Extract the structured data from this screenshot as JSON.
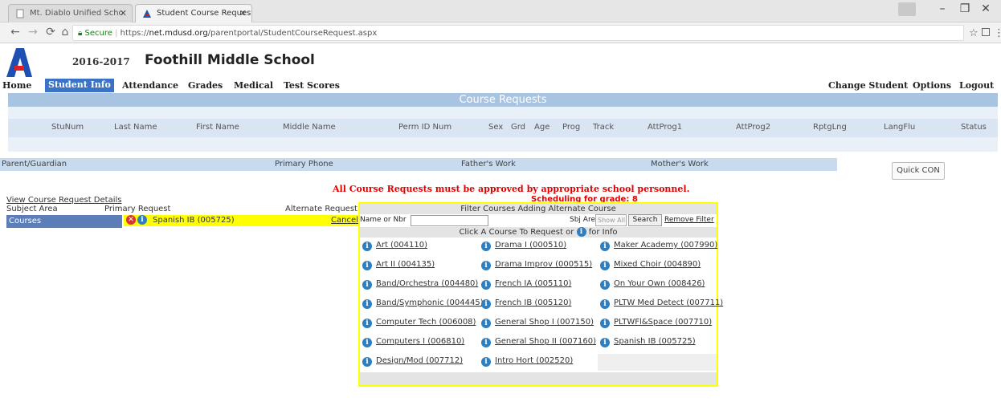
{
  "browser": {
    "tabs": [
      {
        "title": "Mt. Diablo Unified Scho"
      },
      {
        "title": "Student Course Requests"
      }
    ],
    "address": {
      "secure_label": "Secure",
      "url_scheme": "https://",
      "url_host": "net.mdusd.org",
      "url_path": "/parentportal/StudentCourseRequest.aspx"
    }
  },
  "header": {
    "year": "2016-2017",
    "school": "Foothill Middle School"
  },
  "nav": {
    "left": [
      "Home",
      "Student Info",
      "Attendance",
      "Grades",
      "Medical",
      "Test Scores"
    ],
    "active": "Student Info",
    "right": [
      "Change Student",
      "Options",
      "Logout"
    ]
  },
  "course_requests": {
    "title": "Course Requests",
    "columns": [
      "StuNum",
      "Last Name",
      "First Name",
      "Middle Name",
      "Perm ID Num",
      "Sex",
      "Grd",
      "Age",
      "Prog",
      "Track",
      "AttProg1",
      "AttProg2",
      "RptgLng",
      "LangFlu",
      "Status"
    ]
  },
  "parent_bar": {
    "labels": [
      "Parent/Guardian",
      "Primary Phone",
      "Father's Work",
      "Mother's Work"
    ],
    "quick_button": "Quick CON"
  },
  "notice": {
    "warning": "All Course Requests must be approved by appropriate school personnel.",
    "scheduling": "Scheduling for grade: 8"
  },
  "details": {
    "link": "View Course Request Details",
    "headers": [
      "Subject Area",
      "Primary Request",
      "Alternate Request"
    ],
    "row": {
      "subject": "Courses",
      "primary": "Spanish IB (005725)",
      "cancel": "Cancel"
    }
  },
  "filter": {
    "title": "Filter Courses Adding Alternate Course",
    "name_label": "Name or Nbr",
    "sbj_label": "Sbj Area",
    "sbj_value": "Show All Courses",
    "search_button": "Search",
    "remove_filter": "Remove Filter",
    "instruction": "Click A Course To Request or",
    "instruction_tail": "for Info",
    "courses": [
      [
        "Art (004110)",
        "Drama I (000510)",
        "Maker Academy (007990)"
      ],
      [
        "Art II (004135)",
        "Drama Improv (000515)",
        "Mixed Choir (004890)"
      ],
      [
        "Band/Orchestra (004480)",
        "French IA (005110)",
        "On Your Own (008426)"
      ],
      [
        "Band/Symphonic (004445)",
        "French IB (005120)",
        "PLTW Med Detect (007711)"
      ],
      [
        "Computer Tech (006008)",
        "General Shop I (007150)",
        "PLTWFl&Space (007710)"
      ],
      [
        "Computers I (006810)",
        "General Shop II (007160)",
        "Spanish IB (005725)"
      ],
      [
        "Design/Mod (007712)",
        "Intro Hort (002520)",
        ""
      ]
    ]
  }
}
